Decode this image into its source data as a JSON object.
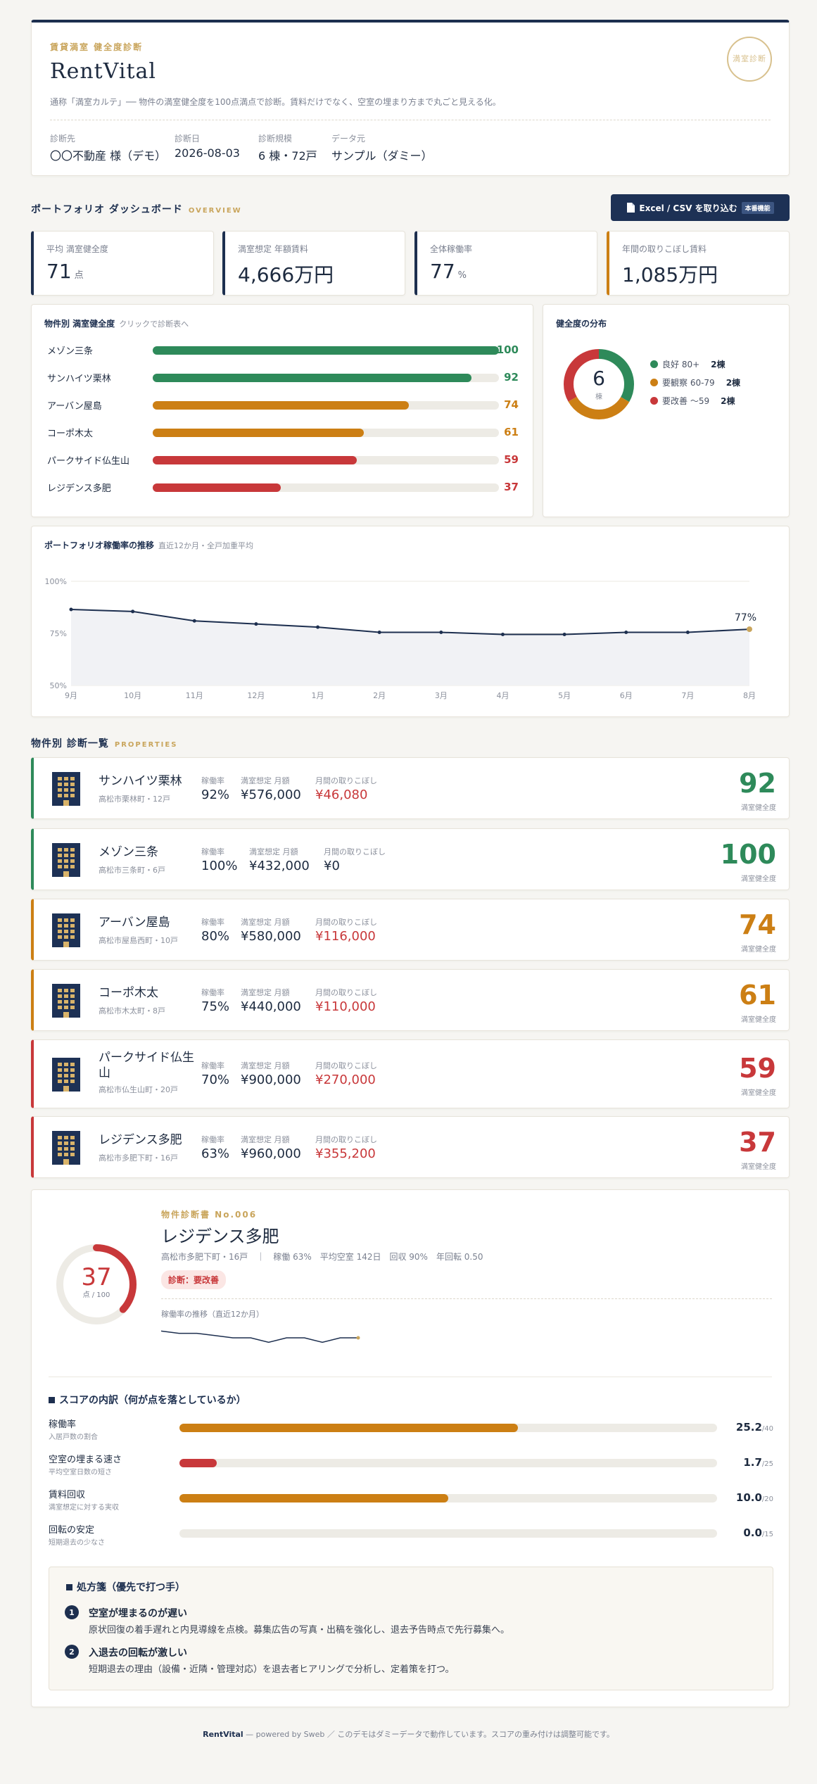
{
  "header": {
    "eyebrow": "賃貸満室 健全度診断",
    "title": "RentVital",
    "description": "通称「満室カルテ」── 物件の満室健全度を100点満点で診断。賃料だけでなく、空室の埋まり方まで丸ごと見える化。",
    "seal_text": "満室診断",
    "meta": [
      {
        "label": "診断先",
        "value": "〇〇不動産 様（デモ）"
      },
      {
        "label": "診断日",
        "value": "2026-08-03"
      },
      {
        "label": "診断規模",
        "value": "6 棟・72戸"
      },
      {
        "label": "データ元",
        "value": "サンプル（ダミー）"
      }
    ]
  },
  "dashboard": {
    "title": "ポートフォリオ ダッシュボード",
    "title_en": "OVERVIEW",
    "import_button": "Excel / CSV を取り込む",
    "import_tag": "本番機能"
  },
  "kpis": [
    {
      "label": "平均 満室健全度",
      "value": "71",
      "unit": "点",
      "accent": "#1d2f4f"
    },
    {
      "label": "満室想定 年額賃料",
      "value": "4,666万円",
      "unit": "",
      "accent": "#1d2f4f"
    },
    {
      "label": "全体稼働率",
      "value": "77",
      "unit": "%",
      "accent": "#1d2f4f"
    },
    {
      "label": "年間の取りこぼし賃料",
      "value": "1,085万円",
      "unit": "",
      "accent": "#cc7f14"
    }
  ],
  "score_bars": {
    "title": "物件別 満室健全度",
    "subtitle": "クリックで診断表へ",
    "items": [
      {
        "name": "メゾン三条",
        "score": 100,
        "color": "#2e8a5a"
      },
      {
        "name": "サンハイツ栗林",
        "score": 92,
        "color": "#2e8a5a"
      },
      {
        "name": "アーバン屋島",
        "score": 74,
        "color": "#cc7f14"
      },
      {
        "name": "コーポ木太",
        "score": 61,
        "color": "#cc7f14"
      },
      {
        "name": "パークサイド仏生山",
        "score": 59,
        "color": "#c8383a"
      },
      {
        "name": "レジデンス多肥",
        "score": 37,
        "color": "#c8383a"
      }
    ]
  },
  "distribution": {
    "title": "健全度の分布",
    "total": "6",
    "total_unit": "棟",
    "segments": [
      {
        "label": "良好 80+",
        "count": 2,
        "count_label": "2棟",
        "color": "#2e8a5a"
      },
      {
        "label": "要観察 60-79",
        "count": 2,
        "count_label": "2棟",
        "color": "#cc7f14"
      },
      {
        "label": "要改善 〜59",
        "count": 2,
        "count_label": "2棟",
        "color": "#c8383a"
      }
    ]
  },
  "trend": {
    "title": "ポートフォリオ稼働率の推移",
    "subtitle": "直近12か月・全戸加重平均",
    "last_label": "77%",
    "chart_data": {
      "type": "line",
      "x": [
        "9月",
        "10月",
        "11月",
        "12月",
        "1月",
        "2月",
        "3月",
        "4月",
        "5月",
        "6月",
        "7月",
        "8月"
      ],
      "series": [
        {
          "values": [
            86.5,
            85.5,
            81,
            79.5,
            78,
            75.5,
            75.5,
            74.5,
            74.5,
            75.5,
            75.5,
            77
          ]
        }
      ],
      "ylim": [
        50,
        100
      ],
      "yticks": [
        "100%",
        "75%",
        "50%"
      ],
      "grid": true
    }
  },
  "properties_section": {
    "title": "物件別 診断一覧",
    "title_en": "PROPERTIES"
  },
  "properties": [
    {
      "name": "サンハイツ栗林",
      "address": "高松市栗林町・12戸",
      "occupancy": "92%",
      "rent": "¥576,000",
      "loss": "¥46,080",
      "loss_red": true,
      "score": "92",
      "color": "#2e8a5a"
    },
    {
      "name": "メゾン三条",
      "address": "高松市三条町・6戸",
      "occupancy": "100%",
      "rent": "¥432,000",
      "loss": "¥0",
      "loss_red": false,
      "score": "100",
      "color": "#2e8a5a"
    },
    {
      "name": "アーバン屋島",
      "address": "高松市屋島西町・10戸",
      "occupancy": "80%",
      "rent": "¥580,000",
      "loss": "¥116,000",
      "loss_red": true,
      "score": "74",
      "color": "#cc7f14"
    },
    {
      "name": "コーポ木太",
      "address": "高松市木太町・8戸",
      "occupancy": "75%",
      "rent": "¥440,000",
      "loss": "¥110,000",
      "loss_red": true,
      "score": "61",
      "color": "#cc7f14"
    },
    {
      "name": "パークサイド仏生山",
      "address": "高松市仏生山町・20戸",
      "occupancy": "70%",
      "rent": "¥900,000",
      "loss": "¥270,000",
      "loss_red": true,
      "score": "59",
      "color": "#c8383a"
    },
    {
      "name": "レジデンス多肥",
      "address": "高松市多肥下町・16戸",
      "occupancy": "63%",
      "rent": "¥960,000",
      "loss": "¥355,200",
      "loss_red": true,
      "score": "37",
      "color": "#c8383a"
    }
  ],
  "property_labels": {
    "occupancy": "稼働率",
    "rent": "満室想定 月額",
    "loss": "月間の取りこぼし",
    "score": "満室健全度"
  },
  "detail": {
    "eyebrow": "物件診断書 No.006",
    "name": "レジデンス多肥",
    "subline": "高松市多肥下町・16戸　｜　稼働 63%　平均空室 142日　回収 90%　年回転 0.50",
    "badge": "診断：要改善",
    "score": "37",
    "score_value": 37,
    "score_unit": "点 / 100",
    "trend_label": "稼働率の推移（直近12か月）",
    "sparkline": [
      68,
      67,
      67,
      66,
      65,
      65,
      63,
      65,
      65,
      63,
      65,
      65
    ],
    "breakdown_title": "スコアの内訳（何が点を落としているか）",
    "breakdown": [
      {
        "label": "稼働率",
        "sub": "入居戸数の割合",
        "value": "25.2",
        "max": "/40",
        "ratio": 0.63,
        "color": "#cc7f14"
      },
      {
        "label": "空室の埋まる速さ",
        "sub": "平均空室日数の短さ",
        "value": "1.7",
        "max": "/25",
        "ratio": 0.07,
        "color": "#c8383a"
      },
      {
        "label": "賃料回収",
        "sub": "満室想定に対する実収",
        "value": "10.0",
        "max": "/20",
        "ratio": 0.5,
        "color": "#cc7f14"
      },
      {
        "label": "回転の安定",
        "sub": "短期退去の少なさ",
        "value": "0.0",
        "max": "/15",
        "ratio": 0,
        "color": "#c8383a"
      }
    ],
    "rx_title": "処方箋（優先で打つ手）",
    "rx": [
      {
        "num": "1",
        "title": "空室が埋まるのが遅い",
        "desc": "原状回復の着手遅れと内見導線を点検。募集広告の写真・出稿を強化し、退去予告時点で先行募集へ。"
      },
      {
        "num": "2",
        "title": "入退去の回転が激しい",
        "desc": "短期退去の理由（設備・近隣・管理対応）を退去者ヒアリングで分析し、定着策を打つ。"
      }
    ]
  },
  "footer": {
    "brand": "RentVital",
    "text": " — powered by Sweb ／ このデモはダミーデータで動作しています。スコアの重み付けは調整可能です。"
  }
}
